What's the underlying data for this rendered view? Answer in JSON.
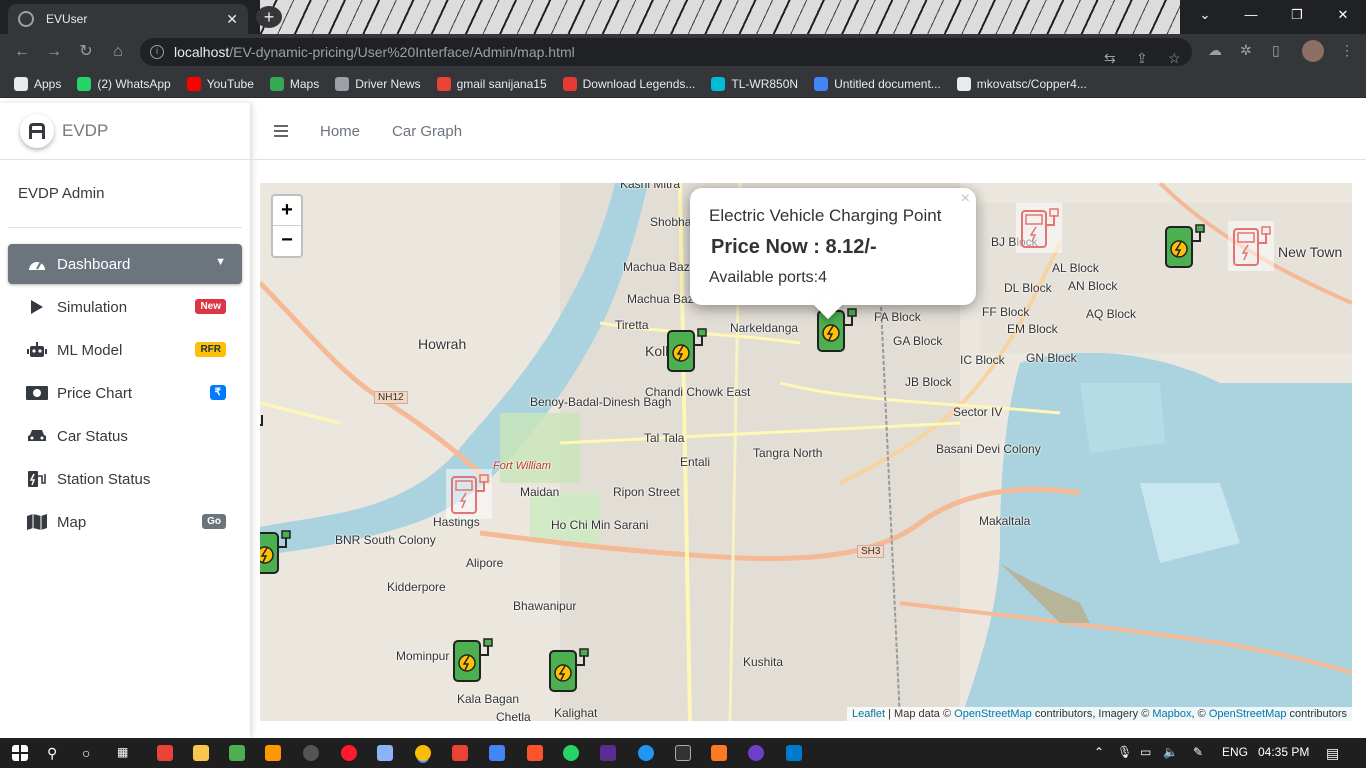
{
  "browser": {
    "tab_title": "EVUser",
    "tab_close": "✕",
    "new_tab": "+",
    "url_host": "localhost",
    "url_path": "/EV-dynamic-pricing/User%20Interface/Admin/map.html",
    "bookmarks": [
      {
        "label": "Apps",
        "color": "#e8eaed"
      },
      {
        "label": "(2) WhatsApp",
        "color": "#25d366"
      },
      {
        "label": "YouTube",
        "color": "#ff0000"
      },
      {
        "label": "Maps",
        "color": "#34a853"
      },
      {
        "label": "Driver News",
        "color": "#9aa0a6"
      },
      {
        "label": "gmail sanijana15",
        "color": "#ea4335"
      },
      {
        "label": "Download Legends...",
        "color": "#e53935"
      },
      {
        "label": "TL-WR850N",
        "color": "#00bcd4"
      },
      {
        "label": "Untitled document...",
        "color": "#4285f4"
      },
      {
        "label": "mkovatsc/Copper4...",
        "color": "#e8eaed"
      }
    ]
  },
  "app": {
    "brand": "EVDP",
    "user": "EVDP Admin",
    "topnav": {
      "home": "Home",
      "car_graph": "Car Graph"
    },
    "nav": [
      {
        "label": "Dashboard",
        "icon": "tachometer-icon",
        "active": true
      },
      {
        "label": "Simulation",
        "icon": "play-icon",
        "badge": "New"
      },
      {
        "label": "ML Model",
        "icon": "robot-icon",
        "badge": "RFR"
      },
      {
        "label": "Price Chart",
        "icon": "money-bill-icon",
        "badge": "₹"
      },
      {
        "label": "Car Status",
        "icon": "car-icon"
      },
      {
        "label": "Station Status",
        "icon": "charging-station-icon"
      },
      {
        "label": "Map",
        "icon": "map-icon",
        "badge": "Go"
      }
    ]
  },
  "map": {
    "zoom_in": "+",
    "zoom_out": "−",
    "popup": {
      "title": "Electric Vehicle Charging Point",
      "price": "Price Now : 8.12/-",
      "ports": "Available ports:4",
      "close": "×"
    },
    "places": [
      "Kashi Mitra",
      "Shobhabazar",
      "Machua Bazar North",
      "Machua Bazar",
      "Tiretta",
      "Narkeldanga",
      "Howrah",
      "Kolkata",
      "Chandi Chowk East",
      "Benoy-Badal-Dinesh Bagh",
      "Tal Tala",
      "Entali",
      "Tangra North",
      "Fort William",
      "Maidan",
      "Ripon Street",
      "Ho Chi Min Sarani",
      "BNR South Colony",
      "Alipore",
      "Kidderpore",
      "Bhawanipur",
      "Mominpur",
      "Kala Bagan",
      "Chetla",
      "Kalighat",
      "Kushita",
      "FA Block",
      "GA Block",
      "JB Block",
      "IC Block",
      "GN Block",
      "Sector IV",
      "Basani Devi Colony",
      "Makaltala",
      "DL Block",
      "AN Block",
      "FF Block",
      "EM Block",
      "AQ Block",
      "AL Block",
      "BJ Block",
      "New Town",
      "Hastings",
      "NH12",
      "SH3"
    ],
    "attribution": {
      "leaflet": "Leaflet",
      "text1": " | Map data © ",
      "osm": "OpenStreetMap",
      "text2": " contributors, Imagery © ",
      "mapbox": "Mapbox",
      "text3": ", © ",
      "osm2": "OpenStreetMap",
      "text4": " contributors"
    },
    "colors": {
      "water": "#aad3df",
      "green_marker": "#4caf50",
      "red_marker": "#e57373"
    }
  },
  "taskbar": {
    "lang": "ENG",
    "time": "04:35 PM"
  }
}
